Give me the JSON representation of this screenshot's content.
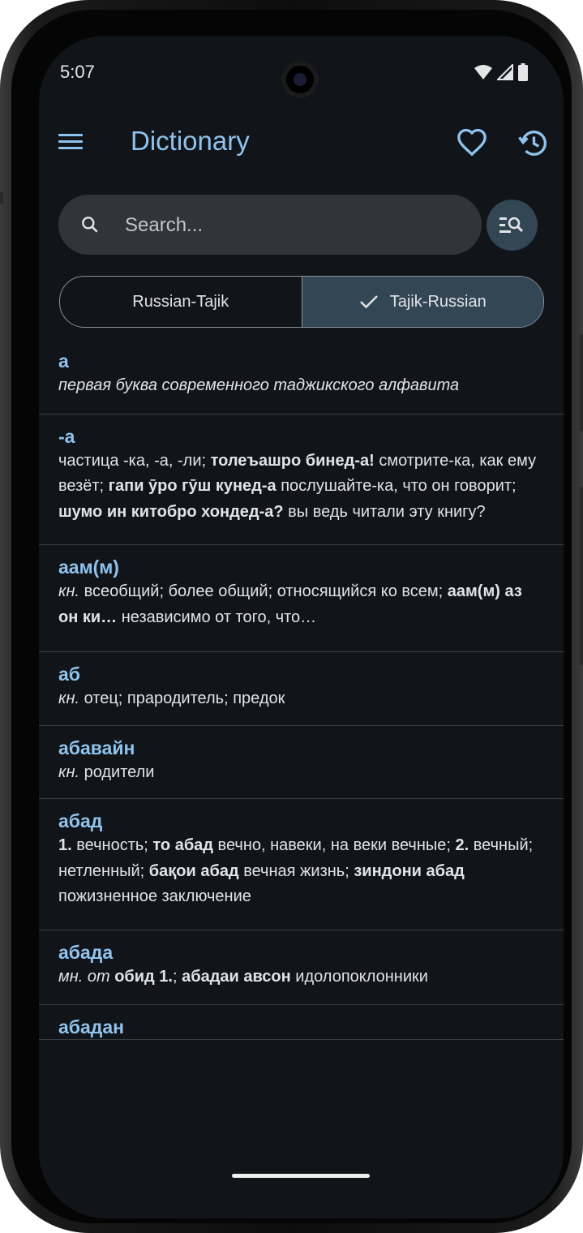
{
  "status_bar": {
    "time": "5:07"
  },
  "app_bar": {
    "title": "Dictionary"
  },
  "search": {
    "placeholder": "Search..."
  },
  "direction_toggle": {
    "left_label": "Russian-Tajik",
    "right_label": "Tajik-Russian",
    "selected": "Tajik-Russian"
  },
  "entries": [
    {
      "headword": "а",
      "parts": [
        {
          "style": "i",
          "text": "первая буква современного таджикского алфавита"
        }
      ]
    },
    {
      "headword": "-а",
      "parts": [
        {
          "style": "n",
          "text": "частица -ка, -а, -ли; "
        },
        {
          "style": "b",
          "text": "толеъашро бинед-а!"
        },
        {
          "style": "n",
          "text": " смотрите-ка, как ему везёт; "
        },
        {
          "style": "b",
          "text": "гапи ӯро гӯш кунед-а"
        },
        {
          "style": "n",
          "text": " послушайте-ка, что он говорит; "
        },
        {
          "style": "b",
          "text": "шумо ин китобро хондед-а?"
        },
        {
          "style": "n",
          "text": " вы ведь читали эту книгу?"
        }
      ]
    },
    {
      "headword": "аам(м)",
      "parts": [
        {
          "style": "i",
          "text": "кн."
        },
        {
          "style": "n",
          "text": " всеобщий; более общий; относящийся ко всем; "
        },
        {
          "style": "b",
          "text": "аам(м) аз он ки…"
        },
        {
          "style": "n",
          "text": " независимо от того, что…"
        }
      ]
    },
    {
      "headword": "аб",
      "parts": [
        {
          "style": "i",
          "text": "кн."
        },
        {
          "style": "n",
          "text": " отец; прародитель; предок"
        }
      ]
    },
    {
      "headword": "абавайн",
      "parts": [
        {
          "style": "i",
          "text": "кн."
        },
        {
          "style": "n",
          "text": " родители"
        }
      ]
    },
    {
      "headword": "абад",
      "parts": [
        {
          "style": "b",
          "text": "1."
        },
        {
          "style": "n",
          "text": " вечность; "
        },
        {
          "style": "b",
          "text": "то абад"
        },
        {
          "style": "n",
          "text": " вечно, навеки, на веки вечные; "
        },
        {
          "style": "b",
          "text": "2."
        },
        {
          "style": "n",
          "text": " вечный; нетленный; "
        },
        {
          "style": "b",
          "text": "бақои абад"
        },
        {
          "style": "n",
          "text": " вечная жизнь; "
        },
        {
          "style": "b",
          "text": "зиндони абад"
        },
        {
          "style": "n",
          "text": " пожизненное заключение"
        }
      ]
    },
    {
      "headword": "абада",
      "parts": [
        {
          "style": "i",
          "text": "мн. от"
        },
        {
          "style": "n",
          "text": " "
        },
        {
          "style": "b",
          "text": "обид 1."
        },
        {
          "style": "n",
          "text": "; "
        },
        {
          "style": "b",
          "text": "абадаи авсон"
        },
        {
          "style": "n",
          "text": " идолопоклонники"
        }
      ]
    },
    {
      "headword": "абадан",
      "parts": []
    }
  ],
  "colors": {
    "accent": "#8fc3ee",
    "background": "#111418",
    "surface": "#31353a",
    "selected": "#334654",
    "text": "#e3e3e6",
    "divider": "#3a3e43"
  }
}
